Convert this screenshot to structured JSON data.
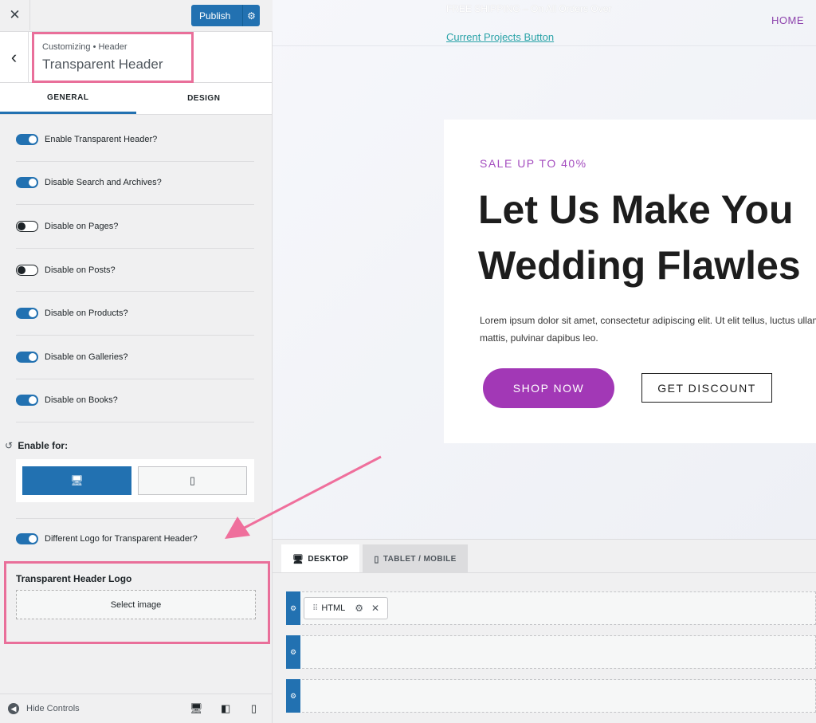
{
  "topbar": {
    "close_icon": "✕",
    "publish_label": "Publish",
    "publish_gear": "⚙"
  },
  "section": {
    "back_icon": "‹",
    "breadcrumb": "Customizing • Header",
    "title": "Transparent Header"
  },
  "tabs": [
    {
      "label": "GENERAL",
      "active": true
    },
    {
      "label": "DESIGN",
      "active": false
    }
  ],
  "options": [
    {
      "label": "Enable Transparent Header?",
      "on": true
    },
    {
      "label": "Disable Search and Archives?",
      "on": true
    },
    {
      "label": "Disable on Pages?",
      "on": false
    },
    {
      "label": "Disable on Posts?",
      "on": false
    },
    {
      "label": "Disable on Products?",
      "on": true
    },
    {
      "label": "Disable on Galleries?",
      "on": true
    },
    {
      "label": "Disable on Books?",
      "on": true
    }
  ],
  "enable_for": {
    "reset_icon": "↺",
    "label": "Enable for:",
    "desktop_icon": "🖥",
    "mobile_icon": "▯"
  },
  "different_logo": {
    "label": "Different Logo for Transparent Header?",
    "on": true
  },
  "logo_box": {
    "title": "Transparent Header Logo",
    "select_label": "Select image"
  },
  "footer": {
    "hide_icon": "◀",
    "hide_label": "Hide Controls",
    "desktop_icon": "🖥",
    "tablet_icon": "◧",
    "mobile_icon": "▯"
  },
  "preview": {
    "top_note": "FREE SHIPPING – On All Orders Over",
    "projects_link": "Current Projects Button",
    "home_link": "HOME",
    "sale_text": "SALE UP TO 40%",
    "hero_line1": "Let Us Make You",
    "hero_line2": "Wedding Flawles",
    "hero_desc": "Lorem ipsum dolor sit amet, consectetur adipiscing elit. Ut elit tellus, luctus ullamcorper mattis, pulvinar dapibus leo.",
    "shop_now": "SHOP NOW",
    "get_discount": "GET DISCOUNT"
  },
  "builder": {
    "tab_desktop": "DESKTOP",
    "tab_desktop_icon": "🖥",
    "tab_mobile": "TABLET / MOBILE",
    "tab_mobile_icon": "▯",
    "row_handle": "⚙",
    "chip_drag": "⠿",
    "chip_label": "HTML",
    "chip_gear": "⚙",
    "chip_close": "✕"
  },
  "colors": {
    "accent": "#2271b1",
    "highlight": "#e96f9a",
    "brand_purple": "#a238b6"
  }
}
